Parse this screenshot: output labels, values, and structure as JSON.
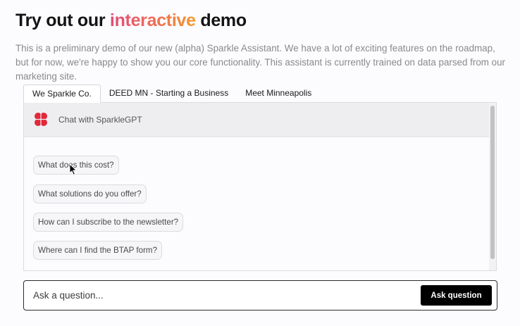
{
  "header": {
    "title_before": "Try out our",
    "title_accent": "interactive",
    "title_after": "demo",
    "description": "This is a preliminary demo of our new (alpha) Sparkle Assistant. We have a lot of exciting features on the roadmap, but for now, we're happy to show you our core functionality. This assistant is currently trained on data parsed from our marketing site."
  },
  "tabs": [
    {
      "label": "We Sparkle Co.",
      "active": true
    },
    {
      "label": "DEED MN - Starting a Business",
      "active": false
    },
    {
      "label": "Meet Minneapolis",
      "active": false
    }
  ],
  "chat": {
    "title": "Chat with SparkleGPT",
    "logo_icon": "clover-icon",
    "logo_color": "#e0293a",
    "suggestions": [
      "What does this cost?",
      "What solutions do you offer?",
      "How can I subscribe to the newsletter?",
      "Where can I find the BTAP form?"
    ]
  },
  "ask": {
    "placeholder": "Ask a question...",
    "button_label": "Ask question"
  },
  "colors": {
    "accent_gradient": [
      "#e04e7a",
      "#f49a2e"
    ],
    "button_bg": "#000000"
  }
}
